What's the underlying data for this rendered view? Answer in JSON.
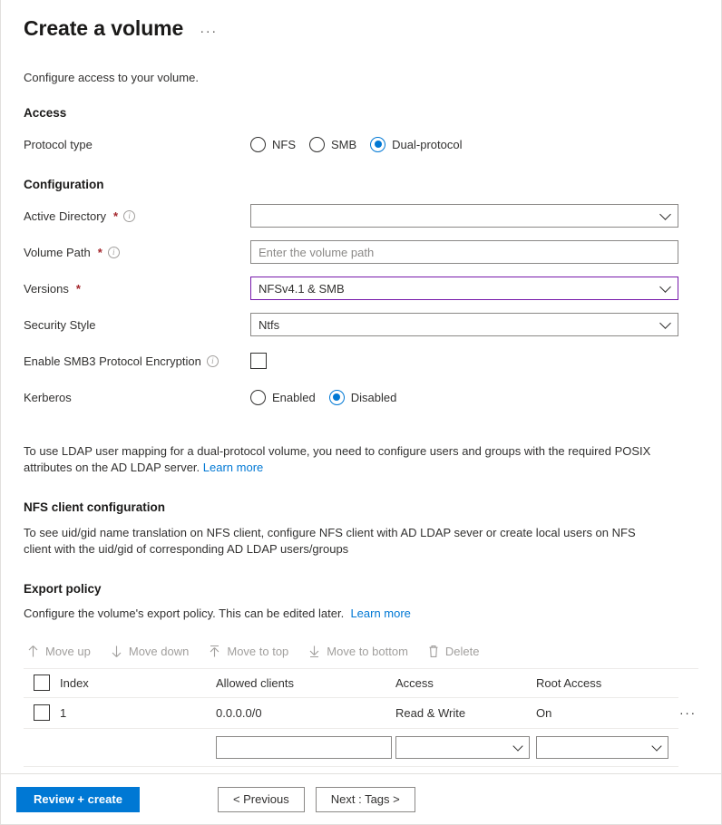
{
  "header": {
    "title": "Create a volume",
    "more_menu": "···"
  },
  "intro": "Configure access to your volume.",
  "access": {
    "section_title": "Access",
    "protocol_type": {
      "label": "Protocol type",
      "options": [
        "NFS",
        "SMB",
        "Dual-protocol"
      ],
      "selected": "Dual-protocol"
    }
  },
  "configuration": {
    "section_title": "Configuration",
    "active_directory": {
      "label": "Active Directory",
      "required": "*",
      "value": "",
      "info": "i"
    },
    "volume_path": {
      "label": "Volume Path",
      "required": "*",
      "placeholder": "Enter the volume path",
      "value": "",
      "info": "i"
    },
    "versions": {
      "label": "Versions",
      "required": "*",
      "value": "NFSv4.1 & SMB",
      "focus_color": "#7719aa"
    },
    "security_style": {
      "label": "Security Style",
      "value": "Ntfs"
    },
    "smb3_encryption": {
      "label": "Enable SMB3 Protocol Encryption",
      "checked": false,
      "info": "i"
    },
    "kerberos": {
      "label": "Kerberos",
      "options": [
        "Enabled",
        "Disabled"
      ],
      "selected": "Disabled"
    }
  },
  "ldap_note": {
    "text": "To use LDAP user mapping for a dual-protocol volume, you need to configure users and groups with the required POSIX attributes on the AD LDAP server.",
    "link": "Learn more"
  },
  "nfs_client": {
    "heading": "NFS client configuration",
    "text": "To see uid/gid name translation on NFS client, configure NFS client with AD LDAP sever or create local users on NFS client with the uid/gid of corresponding AD LDAP users/groups"
  },
  "export_policy": {
    "heading": "Export policy",
    "description": "Configure the volume's export policy. This can be edited later.",
    "link": "Learn more",
    "toolbar": [
      {
        "label": "Move up",
        "icon": "arrow-up-icon",
        "disabled": true
      },
      {
        "label": "Move down",
        "icon": "arrow-down-icon",
        "disabled": true
      },
      {
        "label": "Move to top",
        "icon": "arrow-to-top-icon",
        "disabled": true
      },
      {
        "label": "Move to bottom",
        "icon": "arrow-to-bottom-icon",
        "disabled": true
      },
      {
        "label": "Delete",
        "icon": "trash-icon",
        "disabled": true
      }
    ],
    "table": {
      "columns": [
        "Index",
        "Allowed clients",
        "Access",
        "Root Access"
      ],
      "rows": [
        {
          "checked": false,
          "index": "1",
          "allowed_clients": "0.0.0.0/0",
          "access": "Read & Write",
          "root_access": "On",
          "more": "···"
        }
      ],
      "new_row": {
        "allowed_clients_value": "",
        "access_value": "",
        "root_access_value": ""
      }
    }
  },
  "footer": {
    "review_create": "Review + create",
    "previous": "< Previous",
    "next": "Next : Tags >",
    "primary_color": "#0078d4"
  }
}
